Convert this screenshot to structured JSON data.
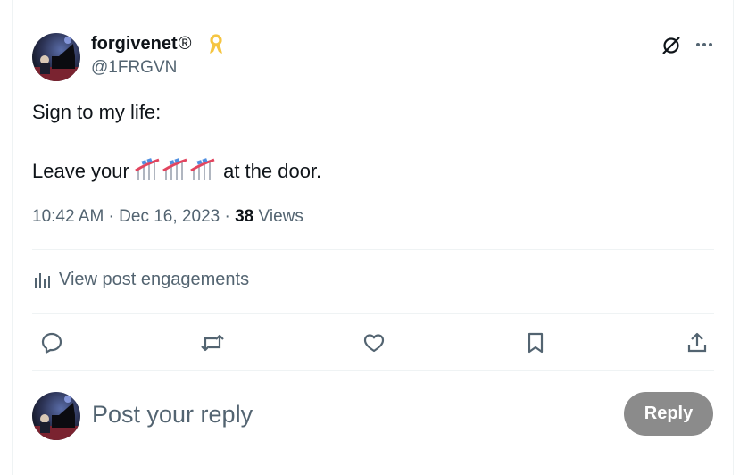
{
  "post": {
    "author": {
      "display_name": "forgivenet",
      "registered_mark": "®",
      "handle": "@1FRGVN"
    },
    "text_line1": "Sign to my life:",
    "text_line2_before": "Leave your ",
    "text_line2_emoji": "roller-coaster-emoji",
    "text_line2_emoji_count": 3,
    "text_line2_after": " at the door.",
    "time": "10:42 AM",
    "separator": " · ",
    "date": "Dec 16, 2023",
    "views_count": "38",
    "views_label": "Views"
  },
  "engagements": {
    "label": "View post engagements"
  },
  "actions": [
    "reply-icon",
    "repost-icon",
    "like-icon",
    "bookmark-icon",
    "share-icon"
  ],
  "composer": {
    "placeholder": "Post your reply",
    "reply_label": "Reply"
  },
  "colors": {
    "text": "#0f1419",
    "secondary": "#536471",
    "divider": "#eff3f4",
    "reply_button": "#8b8b8b",
    "ribbon": "#f5c542"
  }
}
